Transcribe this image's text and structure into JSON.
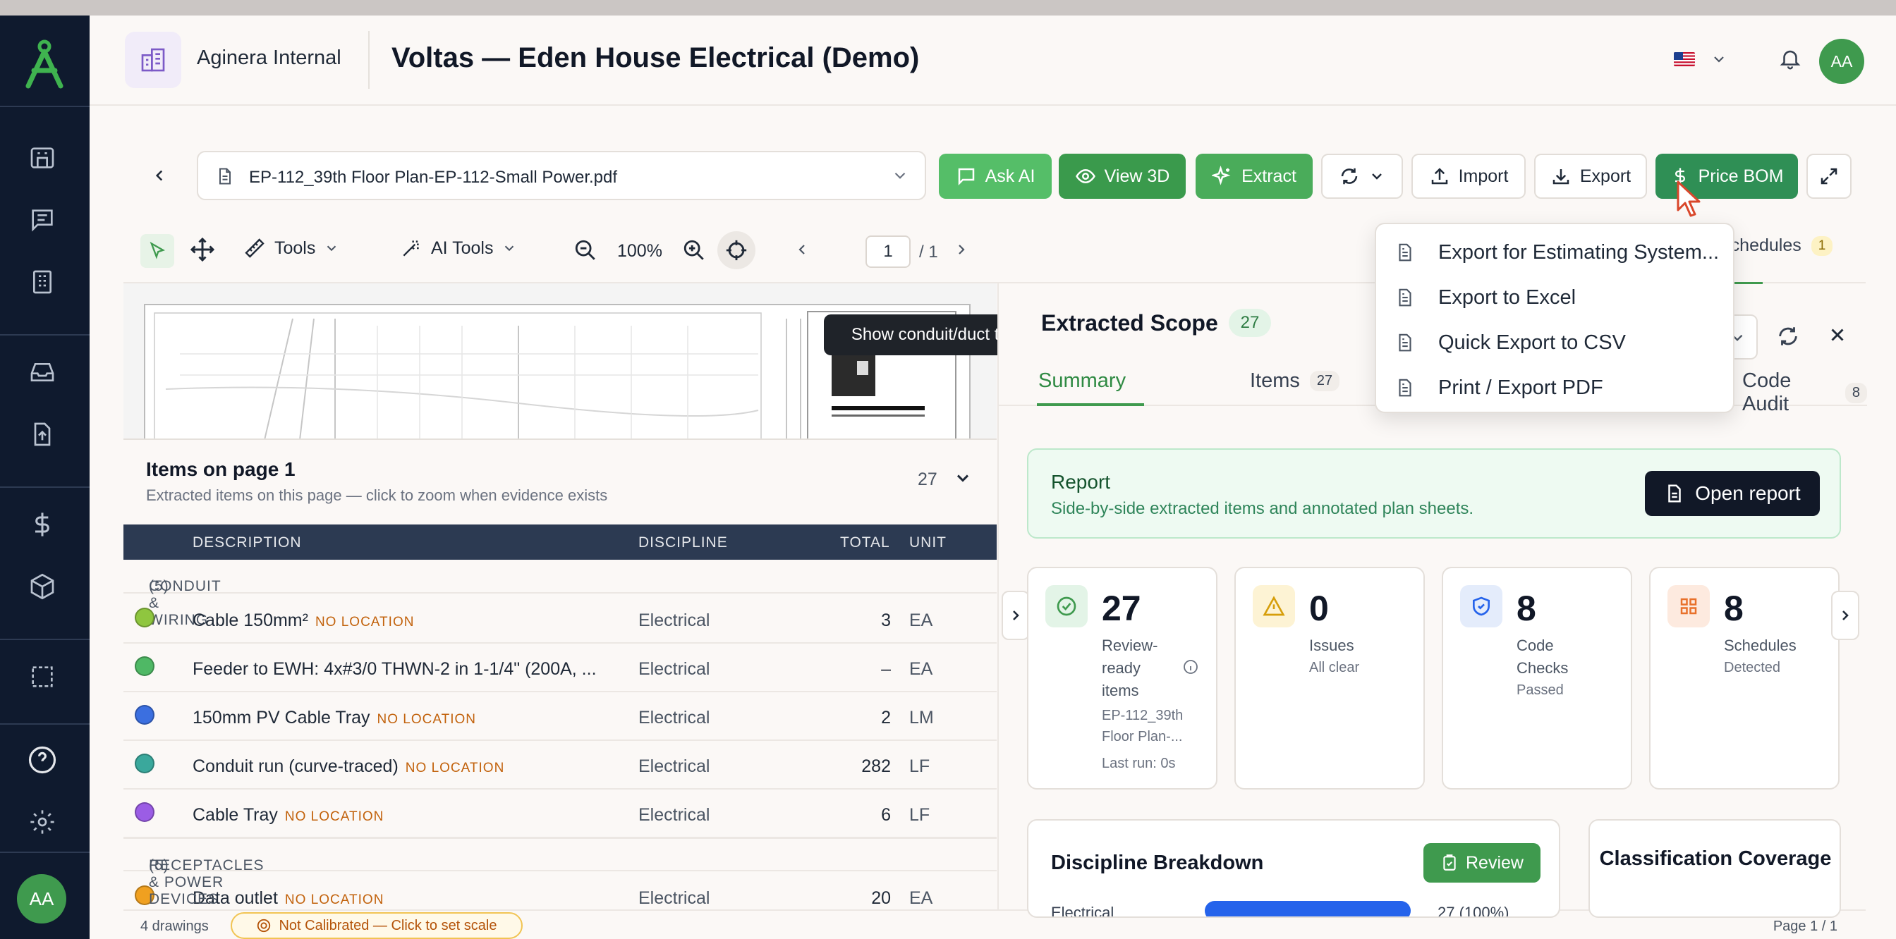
{
  "header": {
    "org_name": "Aginera Internal",
    "project_title": "Voltas — Eden House Electrical (Demo)",
    "user_initials": "AA"
  },
  "sidebar": {
    "items": [
      "projects",
      "messages",
      "buildings",
      "inbox",
      "upload",
      "pricing",
      "packages",
      "selection",
      "help",
      "settings"
    ],
    "user_initials": "AA"
  },
  "toolbar": {
    "file_name": "EP-112_39th Floor Plan-EP-112-Small Power.pdf",
    "ask_ai": "Ask AI",
    "view_3d": "View 3D",
    "extract": "Extract",
    "import": "Import",
    "export": "Export",
    "price_bom": "Price BOM"
  },
  "tools": {
    "tools_label": "Tools",
    "ai_tools_label": "AI Tools",
    "zoom": "100%",
    "page_current": "1",
    "page_total": "/ 1"
  },
  "tooltip": "Show conduit/duct traces",
  "items_panel": {
    "title": "Items on page 1",
    "subtitle": "Extracted items on this page — click to zoom when evidence exists",
    "count": "27",
    "columns": [
      "DESCRIPTION",
      "DISCIPLINE",
      "TOTAL",
      "UNIT"
    ],
    "groups": [
      {
        "label": "CONDUIT & WIRING",
        "count": "(5)"
      },
      {
        "label": "RECEPTACLES & POWER DEVICES",
        "count": "(5)"
      }
    ],
    "rows": [
      {
        "desc": "Cable 150mm²",
        "loc": "NO LOCATION",
        "disc": "Electrical",
        "total": "3",
        "unit": "EA",
        "color": "#8fc63f"
      },
      {
        "desc": "Feeder to EWH: 4x#3/0 THWN-2 in 1-1/4\" (200A, ...",
        "loc": "",
        "disc": "Electrical",
        "total": "–",
        "unit": "EA",
        "color": "#4fb865"
      },
      {
        "desc": "150mm PV Cable Tray",
        "loc": "NO LOCATION",
        "disc": "Electrical",
        "total": "2",
        "unit": "LM",
        "color": "#3b6fe0"
      },
      {
        "desc": "Conduit run (curve-traced)",
        "loc": "NO LOCATION",
        "disc": "Electrical",
        "total": "282",
        "unit": "LF",
        "color": "#3aa89c"
      },
      {
        "desc": "Cable Tray",
        "loc": "NO LOCATION",
        "disc": "Electrical",
        "total": "6",
        "unit": "LF",
        "color": "#9b5de5"
      },
      {
        "desc": "Data outlet",
        "loc": "NO LOCATION",
        "disc": "Electrical",
        "total": "20",
        "unit": "EA",
        "color": "#f0a020"
      }
    ]
  },
  "status": {
    "drawings": "4 drawings",
    "calibration": "Not Calibrated — Click to set scale",
    "page": "Page 1 / 1"
  },
  "right_pane": {
    "title": "Extracted Scope",
    "count": "27",
    "schedules_tab": "Schedules",
    "schedules_count": "1",
    "tabs": [
      {
        "label": "Summary",
        "count": ""
      },
      {
        "label": "Items",
        "count": "27"
      },
      {
        "label": "Code Audit",
        "count": "8"
      }
    ],
    "report": {
      "title": "Report",
      "subtitle": "Side-by-side extracted items and annotated plan sheets.",
      "button": "Open report"
    },
    "cards": [
      {
        "num": "27",
        "label": "Review-ready items",
        "sub": "EP-112_39th Floor Plan-...",
        "sub2": "Last run: 0s"
      },
      {
        "num": "0",
        "label": "Issues",
        "sub": "All clear",
        "sub2": ""
      },
      {
        "num": "8",
        "label": "Code Checks",
        "sub": "Passed",
        "sub2": ""
      },
      {
        "num": "8",
        "label": "Schedules",
        "sub": "Detected",
        "sub2": ""
      }
    ],
    "discipline": {
      "title": "Discipline Breakdown",
      "button": "Review",
      "label": "Electrical",
      "value": "27 (100%)",
      "fraction": 1.0
    },
    "classification_title": "Classification Coverage"
  },
  "export_menu": [
    "Export for Estimating System...",
    "Export to Excel",
    "Quick Export to CSV",
    "Print / Export PDF"
  ],
  "colors": {
    "sidebar_bg": "#0f1a2e",
    "brand_green": "#3f9a4e",
    "accent_blue": "#2563eb"
  }
}
